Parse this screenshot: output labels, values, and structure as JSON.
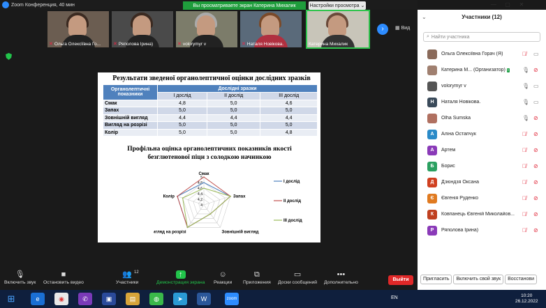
{
  "window": {
    "title": "Zoom Конференция, 40 мин"
  },
  "share_banner": "Вы просматриваете экран Катерина Михалик",
  "view_options": "Настройки просмотра ⌄",
  "view_button": "Вид",
  "videos": [
    {
      "name": "Ольга Олексіївна Го...",
      "muted": true
    },
    {
      "name": "Ряполова Ірина)",
      "muted": true
    },
    {
      "name": "volorymyr v",
      "muted": true
    },
    {
      "name": "Наталя Новікова.",
      "muted": true
    },
    {
      "name": "Катерина Михалик",
      "muted": false,
      "active": true
    }
  ],
  "slide": {
    "title": "Результати зведеної органолептичної оцінки дослідних зразків",
    "table": {
      "col_head_1": "Органолептичні показники",
      "col_group": "Дослідні зразки",
      "sub_heads": [
        "І дослід",
        "ІІ дослід",
        "ІІІ дослід"
      ],
      "rows": [
        {
          "label": "Смак",
          "values": [
            "4,8",
            "5,0",
            "4,6"
          ]
        },
        {
          "label": "Запах",
          "values": [
            "5,0",
            "5,0",
            "5,0"
          ]
        },
        {
          "label": "Зовнішній вигляд",
          "values": [
            "4,4",
            "4,4",
            "4,4"
          ]
        },
        {
          "label": "Вигляд на розрізі",
          "values": [
            "5,0",
            "5,0",
            "5,0"
          ]
        },
        {
          "label": "Колір",
          "values": [
            "5,0",
            "5,0",
            "4,8"
          ]
        }
      ]
    },
    "chart_title_line1": "Профільна оцінка органолептичних показників якості",
    "chart_title_line2": "безглютенової піци з солодкою начинкою"
  },
  "chart_data": {
    "type": "radar",
    "categories": [
      "Смак",
      "Запах",
      "Зовнішній вигляд",
      "Вигляд на розрізі",
      "Колір"
    ],
    "axis_ticks": [
      "5",
      "4,8",
      "4,6",
      "4,4",
      "4,2",
      "4"
    ],
    "rlim": [
      4,
      5
    ],
    "series": [
      {
        "name": "І дослід",
        "values": [
          4.8,
          5.0,
          4.4,
          5.0,
          5.0
        ],
        "color": "#4f81bd"
      },
      {
        "name": "ІІ дослід",
        "values": [
          5.0,
          5.0,
          4.4,
          5.0,
          5.0
        ],
        "color": "#c0504d"
      },
      {
        "name": "ІІІ дослід",
        "values": [
          4.6,
          5.0,
          4.4,
          5.0,
          4.8
        ],
        "color": "#9bbb59"
      }
    ],
    "legend": "right"
  },
  "toolbar": {
    "audio": "Включить звук",
    "video": "Остановить видео",
    "participants": "Участники",
    "participants_count": "12",
    "share": "Демонстрация экрана",
    "reactions": "Реакции",
    "apps": "Приложения",
    "whiteboard": "Доски сообщений",
    "more": "Дополнительно",
    "leave": "Выйти"
  },
  "panel": {
    "title": "Участники (12)",
    "search_placeholder": "Найти участника",
    "participants": [
      {
        "name": "Ольга Олексіївна Горач (Я)",
        "initial": "",
        "color": "#8a6a5a",
        "mic_muted": true,
        "cam_off": false
      },
      {
        "name": "Катерина М... (Организатор)",
        "initial": "",
        "color": "#a08070",
        "mic_muted": false,
        "cam_off": true
      },
      {
        "name": "volorymyr v",
        "initial": "",
        "color": "#555555",
        "mic_muted": false,
        "cam_off": false
      },
      {
        "name": "Наталя Новікова.",
        "initial": "Н",
        "color": "#3a4a5a",
        "mic_muted": false,
        "cam_off": false
      },
      {
        "name": "Olha Sumska",
        "initial": "",
        "color": "#b07060",
        "mic_muted": false,
        "cam_off": true
      },
      {
        "name": "Аліна Остапчук",
        "initial": "А",
        "color": "#2a8ac8",
        "mic_muted": true,
        "cam_off": true
      },
      {
        "name": "Артем",
        "initial": "А",
        "color": "#8a3ab8",
        "mic_muted": true,
        "cam_off": true
      },
      {
        "name": "Борис",
        "initial": "Б",
        "color": "#2aa060",
        "mic_muted": true,
        "cam_off": true
      },
      {
        "name": "Дзюндзя Оксана",
        "initial": "Д",
        "color": "#d04020",
        "mic_muted": true,
        "cam_off": true
      },
      {
        "name": "Євгенія Руденко",
        "initial": "Є",
        "color": "#e07a20",
        "mic_muted": true,
        "cam_off": true
      },
      {
        "name": "Ковпанець Євгеній Миколайов...",
        "initial": "К",
        "color": "#c04020",
        "mic_muted": true,
        "cam_off": true
      },
      {
        "name": "Ряполова Ірина)",
        "initial": "Р",
        "color": "#8a3ab8",
        "mic_muted": true,
        "cam_off": true
      }
    ],
    "invite": "Пригласить",
    "unmute_me": "Включить свой звук",
    "restore": "Восстанови"
  },
  "taskbar": {
    "lang": "EN",
    "time": "10:20",
    "date": "26.12.2022"
  }
}
